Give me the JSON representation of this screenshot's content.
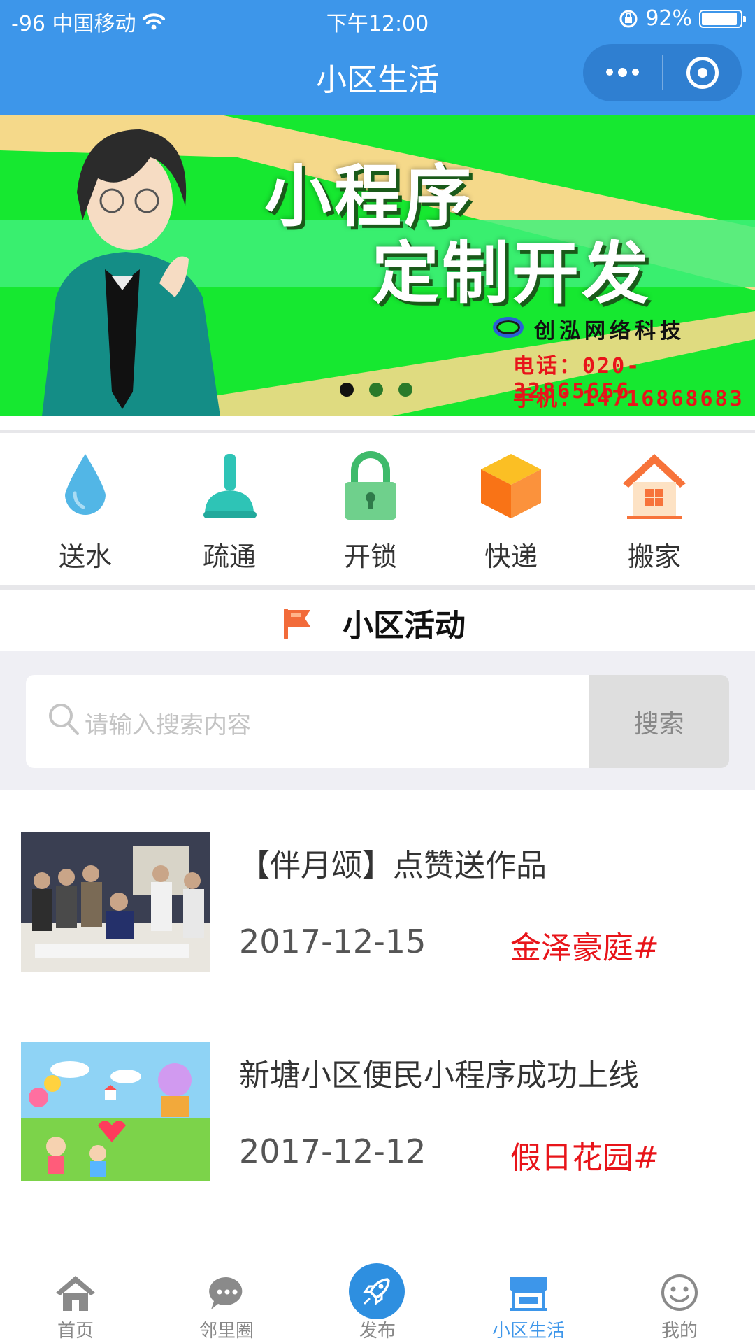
{
  "status_bar": {
    "carrier": "-96 中国移动",
    "time": "下午12:00",
    "battery": "92%",
    "battery_level": 0.92
  },
  "nav": {
    "title": "小区生活"
  },
  "banner": {
    "headline_1": "小程序",
    "headline_2": "定制开发",
    "company": "创泓网络科技",
    "phone": "电话：020-32865656",
    "mobile": "手机：14716868683",
    "page_count": 3,
    "active_page": 1
  },
  "services": [
    {
      "label": "送水",
      "icon": "water-drop-icon"
    },
    {
      "label": "疏通",
      "icon": "plunger-icon"
    },
    {
      "label": "开锁",
      "icon": "padlock-icon"
    },
    {
      "label": "快递",
      "icon": "package-box-icon"
    },
    {
      "label": "搬家",
      "icon": "house-icon"
    }
  ],
  "section": {
    "title": "小区活动",
    "icon": "flag-icon"
  },
  "search": {
    "placeholder": "请输入搜索内容",
    "button_label": "搜索"
  },
  "activities": [
    {
      "title": "【伴月颂】点赞送作品",
      "date": "2017-12-15",
      "tag": "金泽豪庭#"
    },
    {
      "title": "新塘小区便民小程序成功上线",
      "date": "2017-12-12",
      "tag": "假日花园#"
    }
  ],
  "tabs": [
    {
      "label": "首页",
      "icon": "home-icon",
      "active": false
    },
    {
      "label": "邻里圈",
      "icon": "chat-bubble-icon",
      "active": false
    },
    {
      "label": "发布",
      "icon": "rocket-icon",
      "active": false
    },
    {
      "label": "小区生活",
      "icon": "storefront-icon",
      "active": true
    },
    {
      "label": "我的",
      "icon": "smiley-icon",
      "active": false
    }
  ],
  "colors": {
    "nav_blue": "#3d96ea",
    "banner_green": "#16e830",
    "accent_red": "#e8141a",
    "flag_orange": "#f26b3a"
  }
}
